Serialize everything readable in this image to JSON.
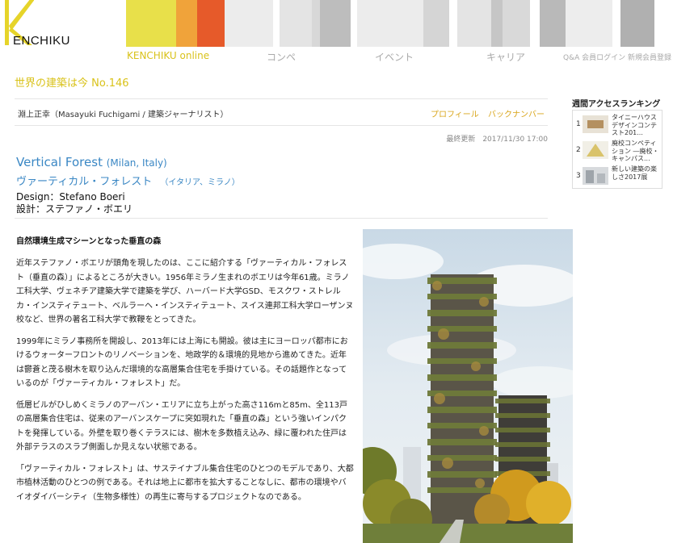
{
  "brand": {
    "logo_letter": "K",
    "logo_text": "ENCHIKU"
  },
  "nav": {
    "items": [
      {
        "label": "KENCHIKU online",
        "active": true
      },
      {
        "label": "コンペ",
        "active": false
      },
      {
        "label": "イベント",
        "active": false
      },
      {
        "label": "キャリア",
        "active": false
      }
    ],
    "right_links": "Q&A 会員ログイン 新規会員登録"
  },
  "series": "世界の建築は今 No.146",
  "author": {
    "name": "淵上正幸（Masayuki Fuchigami / 建築ジャーナリスト）",
    "profile": "プロフィール",
    "backnumber": "バックナンバー"
  },
  "updated": "最終更新　2017/11/30 17:00",
  "article": {
    "title_en": "Vertical Forest",
    "location_en": "(Milan, Italy)",
    "title_ja": "ヴァーティカル・フォレスト",
    "location_ja": "（イタリア、ミラノ）",
    "design_en": "Design：Stefano Boeri",
    "design_ja": "設計：ステファノ・ボエリ",
    "lead": "自然環境生成マシーンとなった垂直の森",
    "paragraphs": [
      "近年ステファノ・ボエリが頭角を現したのは、ここに紹介する「ヴァーティカル・フォレスト（垂直の森）」によるところが大きい。1956年ミラノ生まれのボエリは今年61歳。ミラノ工科大学、ヴェネチア建築大学で建築を学び、ハーバード大学GSD、モスクワ・ストレルカ・インスティテュート、ベルラーヘ・インスティテュート、スイス連邦工科大学ローザンヌ校など、世界の著名工科大学で教鞭をとってきた。",
      "1999年にミラノ事務所を開設し、2013年には上海にも開設。彼は主にヨーロッパ都市におけるウォーターフロントのリノベーションを、地政学的＆環境的見地から進めてきた。近年は鬱蒼と茂る樹木を取り込んだ環境的な高層集合住宅を手掛けている。その話題作となっているのが「ヴァーティカル・フォレスト」だ。",
      "低層ビルがひしめくミラノのアーバン・エリアに立ち上がった高さ116mと85m、全113戸の高層集合住宅は、従来のアーバンスケープに突如現れた「垂直の森」という強いインパクトを発揮している。外壁を取り巻くテラスには、樹木を多数植え込み、緑に覆われた住戸は外部テラスのスラブ側面しか見えない状態である。",
      "「ヴァーティカル・フォレスト」は、サステイナブル集合住宅のひとつのモデルであり、大都市植林活動のひとつの例である。それは地上に都市を拡大することなしに、都市の環境やバイオダイバーシティ（生物多様性）の再生に寄与するプロジェクトなのである。"
    ]
  },
  "ranking": {
    "title": "週間アクセスランキング",
    "items": [
      {
        "num": "1",
        "text": "タイニーハウスデザインコンテスト201..."
      },
      {
        "num": "2",
        "text": "廃校コンペティション ―廃校・キャンパス..."
      },
      {
        "num": "3",
        "text": "新しい建築の楽しさ2017展"
      }
    ]
  },
  "colors": {
    "accent": "#d9c21a",
    "link_blue": "#3a87c4",
    "profile_orange": "#d9a51a"
  }
}
